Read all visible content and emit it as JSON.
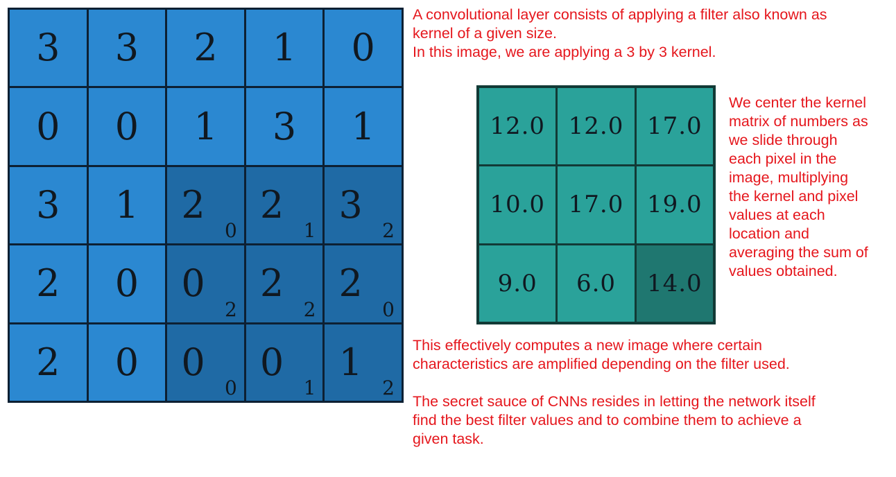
{
  "input_grid": {
    "values": [
      [
        "3",
        "3",
        "2",
        "1",
        "0"
      ],
      [
        "0",
        "0",
        "1",
        "3",
        "1"
      ],
      [
        "3",
        "1",
        "2",
        "2",
        "3"
      ],
      [
        "2",
        "0",
        "0",
        "2",
        "2"
      ],
      [
        "2",
        "0",
        "0",
        "0",
        "1"
      ]
    ],
    "kernel_weights": {
      "2": {
        "2": "0",
        "3": "1",
        "4": "2"
      },
      "3": {
        "2": "2",
        "3": "2",
        "4": "0"
      },
      "4": {
        "2": "0",
        "3": "1",
        "4": "2"
      }
    },
    "kernel_rows": [
      2,
      3,
      4
    ],
    "kernel_cols": [
      2,
      3,
      4
    ],
    "cell_color": "#2b88d1",
    "kernel_color": "#1f6aa5"
  },
  "output_grid": {
    "values": [
      [
        "12.0",
        "12.0",
        "17.0"
      ],
      [
        "10.0",
        "17.0",
        "19.0"
      ],
      [
        "9.0",
        "6.0",
        "14.0"
      ]
    ],
    "current": {
      "row": 2,
      "col": 2
    },
    "cell_color": "#2aa29a",
    "current_color": "#1f7770"
  },
  "notes": {
    "color": "#e5161c",
    "intro": [
      "A convolutional layer consists of applying a filter also known as",
      "kernel of a given size.",
      "In this image, we are applying a 3 by 3 kernel."
    ],
    "kernel": [
      "We center the kernel",
      "matrix of numbers as",
      "we slide through",
      "each pixel in the",
      "image, multiplying",
      "the kernel and pixel",
      "values at each",
      "location and",
      "averaging the sum of",
      "values obtained."
    ],
    "effect": [
      "This effectively computes a new image where certain",
      "characteristics are amplified depending on the filter used."
    ],
    "secret": [
      "The secret sauce of CNNs resides in letting the network itself",
      "find the best filter values and to combine them to achieve a",
      "given task."
    ]
  }
}
